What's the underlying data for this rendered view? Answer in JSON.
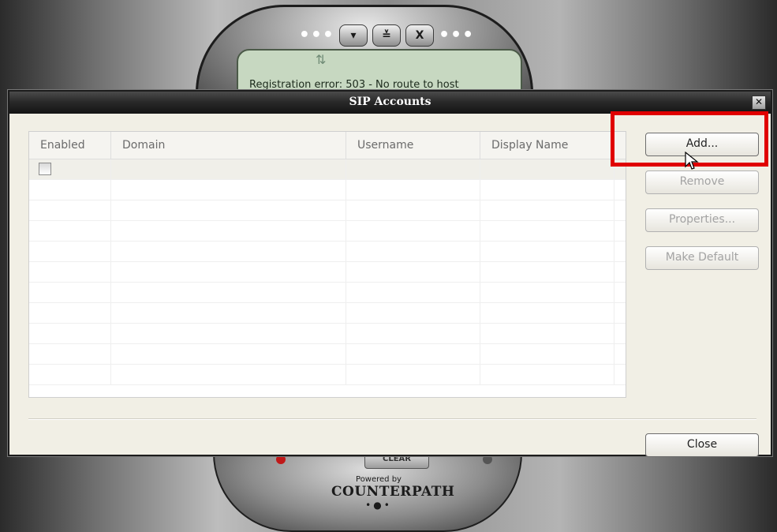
{
  "phone": {
    "controls": [
      "▾",
      "≚",
      "X"
    ],
    "status_text": "Registration error: 503 - No route to host",
    "clear_label": "CLEAR",
    "powered_by": "Powered by",
    "brand": "COUNTERPATH"
  },
  "dialog": {
    "title": "SIP Accounts",
    "close_x": "✕",
    "table": {
      "columns": [
        "Enabled",
        "Domain",
        "Username",
        "Display Name"
      ],
      "rows": [
        {
          "enabled": false,
          "domain": "",
          "username": "",
          "display_name": ""
        }
      ]
    },
    "buttons": {
      "add": "Add...",
      "remove": "Remove",
      "properties": "Properties...",
      "make_default": "Make Default",
      "close": "Close"
    },
    "button_states": {
      "add": "enabled",
      "remove": "disabled",
      "properties": "disabled",
      "make_default": "disabled",
      "close": "enabled"
    }
  },
  "colors": {
    "highlight": "#e00000",
    "titlebar": "#1c1c1c",
    "dialog_bg": "#f1efe5"
  }
}
